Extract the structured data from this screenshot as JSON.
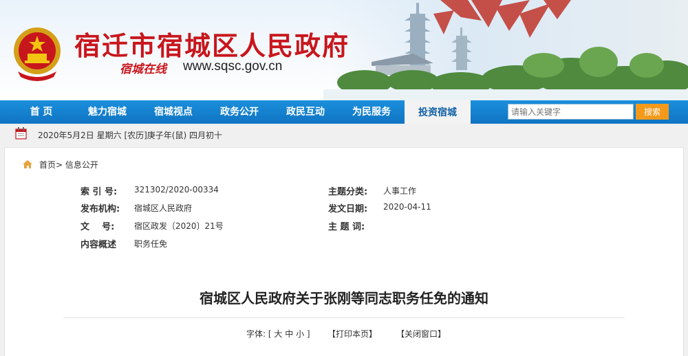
{
  "header": {
    "site_title": "宿迁市宿城区人民政府",
    "sub_logo": "宿城在线",
    "url": "www.sqsc.gov.cn"
  },
  "nav": {
    "items": [
      "首 页",
      "魅力宿城",
      "宿城视点",
      "政务公开",
      "政民互动",
      "为民服务",
      "投资宿城"
    ],
    "active_index": 6,
    "search_placeholder": "请输入关键字",
    "search_button": "搜索"
  },
  "datebar": {
    "text": "2020年5月2日  星期六  [农历]庚子年(鼠) 四月初十"
  },
  "breadcrumb": {
    "home": "首页>",
    "current": "信息公开"
  },
  "meta": {
    "index_no_label": "索 引 号:",
    "index_no": "321302/2020-00334",
    "category_label": "主题分类:",
    "category": "人事工作",
    "publisher_label": "发布机构:",
    "publisher": "宿城区人民政府",
    "date_label": "发文日期:",
    "date": "2020-04-11",
    "docno_label": "文    号:",
    "docno": "宿区政发〔2020〕21号",
    "keywords_label": "主 题 词:",
    "keywords": "",
    "summary_label": "内容概述",
    "summary": "职务任免"
  },
  "document": {
    "title": "宿城区人民政府关于张刚等同志职务任免的通知"
  },
  "tools": {
    "font_label": "字体: [",
    "font_large": "大",
    "font_medium": "中",
    "font_small": "小",
    "font_close": "]",
    "print": "【打印本页】",
    "close": "【关闭窗口】"
  },
  "colors": {
    "brand_red": "#c8161d",
    "nav_blue": "#1b8fdc",
    "search_orange": "#f39a1b"
  }
}
